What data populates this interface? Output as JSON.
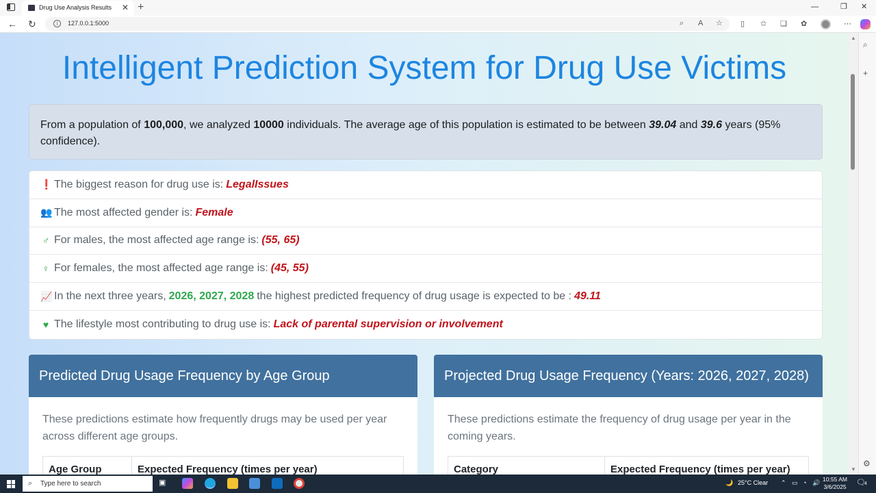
{
  "browser": {
    "tab_title": "Drug Use Analysis Results",
    "url": "127.0.0.1:5000"
  },
  "page": {
    "title": "Intelligent Prediction System for Drug Use Victims",
    "summary": {
      "t1": "From a population of ",
      "population": "100,000",
      "t2": ", we analyzed ",
      "analyzed": "10000",
      "t3": " individuals. The average age of this population is estimated to be between ",
      "age_low": "39.04",
      "t4": " and ",
      "age_high": "39.6",
      "t5": " years (95% confidence)."
    },
    "insights": {
      "reason_label": "The biggest reason for drug use is:",
      "reason_value": "LegalIssues",
      "gender_label": "The most affected gender is:",
      "gender_value": "Female",
      "male_label": "For males, the most affected age range is:",
      "male_value": "(55, 65)",
      "female_label": "For females, the most affected age range is:",
      "female_value": "(45, 55)",
      "freq_label_a": "In the next three years,",
      "freq_years": "2026, 2027, 2028",
      "freq_label_b": "the highest predicted frequency of drug usage is expected to be :",
      "freq_value": "49.11",
      "lifestyle_label": "The lifestyle most contributing to drug use is:",
      "lifestyle_value": "Lack of parental supervision or involvement"
    },
    "cards": [
      {
        "title": "Predicted Drug Usage Frequency by Age Group",
        "description": "These predictions estimate how frequently drugs may be used per year across different age groups.",
        "col1": "Age Group",
        "col2": "Expected Frequency (times per year)"
      },
      {
        "title": "Projected Drug Usage Frequency (Years: 2026, 2027, 2028)",
        "description": "These predictions estimate the frequency of drug usage per year in the coming years.",
        "col1": "Category",
        "col2": "Expected Frequency (times per year)"
      }
    ]
  },
  "taskbar": {
    "search_placeholder": "Type here to search",
    "weather": "25°C  Clear",
    "time": "10:55 AM",
    "date": "3/6/2025",
    "notification_count": "4"
  }
}
